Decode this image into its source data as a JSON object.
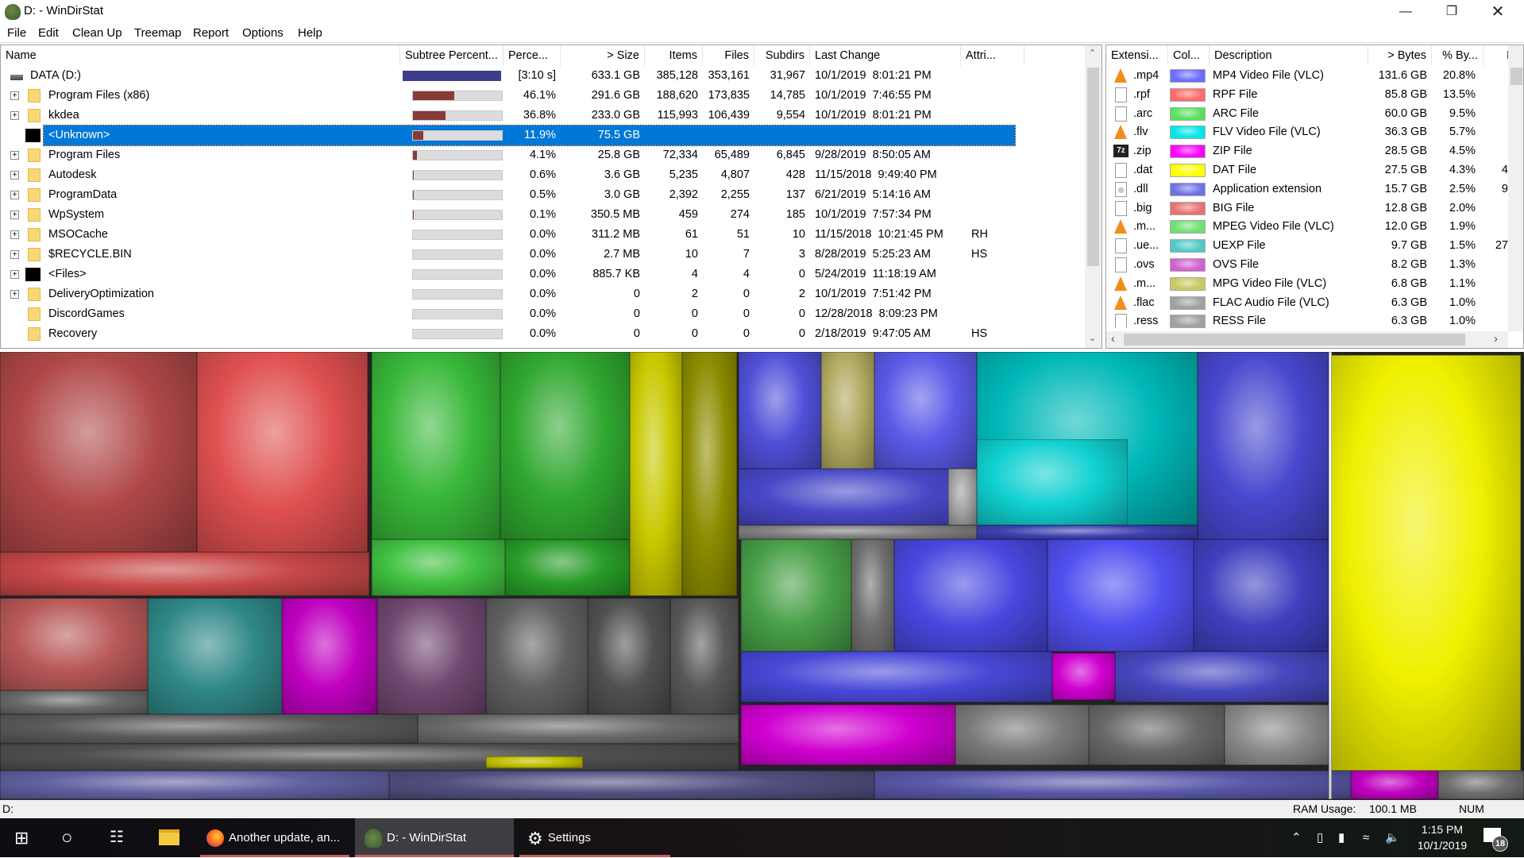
{
  "window": {
    "title": "D: - WinDirStat"
  },
  "menu": [
    "File",
    "Edit",
    "Clean Up",
    "Treemap",
    "Report",
    "Options",
    "Help"
  ],
  "tree": {
    "columns": [
      "Name",
      "Subtree Percent...",
      "Perce...",
      "> Size",
      "Items",
      "Files",
      "Subdirs",
      "Last Change",
      "Attri..."
    ],
    "rows": [
      {
        "name": "DATA (D:)",
        "icon": "drive",
        "expand": false,
        "subtree": 100,
        "perc": "[3:10 s]",
        "size": "633.1 GB",
        "items": "385,128",
        "files": "353,161",
        "subdirs": "31,967",
        "changed": "10/1/2019  8:01:21 PM",
        "attr": ""
      },
      {
        "name": "Program Files (x86)",
        "icon": "folder",
        "expand": true,
        "subtree": 46.1,
        "perc": "46.1%",
        "size": "291.6 GB",
        "items": "188,620",
        "files": "173,835",
        "subdirs": "14,785",
        "changed": "10/1/2019  7:46:55 PM",
        "attr": ""
      },
      {
        "name": "kkdea",
        "icon": "folder",
        "expand": true,
        "subtree": 36.8,
        "perc": "36.8%",
        "size": "233.0 GB",
        "items": "115,993",
        "files": "106,439",
        "subdirs": "9,554",
        "changed": "10/1/2019  8:01:21 PM",
        "attr": ""
      },
      {
        "name": "<Unknown>",
        "icon": "black",
        "expand": false,
        "selected": true,
        "subtree": 11.9,
        "perc": "11.9%",
        "size": "75.5 GB",
        "items": "",
        "files": "",
        "subdirs": "",
        "changed": "",
        "attr": ""
      },
      {
        "name": "Program Files",
        "icon": "folder",
        "expand": true,
        "subtree": 4.1,
        "perc": "4.1%",
        "size": "25.8 GB",
        "items": "72,334",
        "files": "65,489",
        "subdirs": "6,845",
        "changed": "9/28/2019  8:50:05 AM",
        "attr": ""
      },
      {
        "name": "Autodesk",
        "icon": "folder",
        "expand": true,
        "subtree": 0.6,
        "perc": "0.6%",
        "size": "3.6 GB",
        "items": "5,235",
        "files": "4,807",
        "subdirs": "428",
        "changed": "11/15/2018  9:49:40 PM",
        "attr": ""
      },
      {
        "name": "ProgramData",
        "icon": "folder",
        "expand": true,
        "subtree": 0.5,
        "perc": "0.5%",
        "size": "3.0 GB",
        "items": "2,392",
        "files": "2,255",
        "subdirs": "137",
        "changed": "6/21/2019  5:14:16 AM",
        "attr": ""
      },
      {
        "name": "WpSystem",
        "icon": "folder",
        "expand": true,
        "subtree": 0.1,
        "perc": "0.1%",
        "size": "350.5 MB",
        "items": "459",
        "files": "274",
        "subdirs": "185",
        "changed": "10/1/2019  7:57:34 PM",
        "attr": ""
      },
      {
        "name": "MSOCache",
        "icon": "folder",
        "expand": true,
        "subtree": 0.0,
        "perc": "0.0%",
        "size": "311.2 MB",
        "items": "61",
        "files": "51",
        "subdirs": "10",
        "changed": "11/15/2018  10:21:45 PM",
        "attr": "RH"
      },
      {
        "name": "$RECYCLE.BIN",
        "icon": "folder",
        "expand": true,
        "subtree": 0.0,
        "perc": "0.0%",
        "size": "2.7 MB",
        "items": "10",
        "files": "7",
        "subdirs": "3",
        "changed": "8/28/2019  5:25:23 AM",
        "attr": "HS"
      },
      {
        "name": "<Files>",
        "icon": "black",
        "expand": true,
        "subtree": 0.0,
        "perc": "0.0%",
        "size": "885.7 KB",
        "items": "4",
        "files": "4",
        "subdirs": "0",
        "changed": "5/24/2019  11:18:19 AM",
        "attr": ""
      },
      {
        "name": "DeliveryOptimization",
        "icon": "folder",
        "expand": true,
        "subtree": 0.0,
        "perc": "0.0%",
        "size": "0",
        "items": "2",
        "files": "0",
        "subdirs": "2",
        "changed": "10/1/2019  7:51:42 PM",
        "attr": ""
      },
      {
        "name": "DiscordGames",
        "icon": "folder",
        "expand": false,
        "subtree": 0.0,
        "perc": "0.0%",
        "size": "0",
        "items": "0",
        "files": "0",
        "subdirs": "0",
        "changed": "12/28/2018  8:09:23 PM",
        "attr": ""
      },
      {
        "name": "Recovery",
        "icon": "folder",
        "expand": false,
        "subtree": 0.0,
        "perc": "0.0%",
        "size": "0",
        "items": "0",
        "files": "0",
        "subdirs": "0",
        "changed": "2/18/2019  9:47:05 AM",
        "attr": "HS"
      }
    ]
  },
  "extensions": {
    "columns": [
      "Extensi...",
      "Col...",
      "Description",
      "> Bytes",
      "% By...",
      "I"
    ],
    "rows": [
      {
        "ext": ".mp4",
        "icon": "vlc",
        "color": "#6b6bff",
        "desc": "MP4 Video File (VLC)",
        "bytes": "131.6 GB",
        "pct": "20.8%",
        "files": ""
      },
      {
        "ext": ".rpf",
        "icon": "file",
        "color": "#ff6b6b",
        "desc": "RPF File",
        "bytes": "85.8 GB",
        "pct": "13.5%",
        "files": ""
      },
      {
        "ext": ".arc",
        "icon": "file",
        "color": "#5be05b",
        "desc": "ARC File",
        "bytes": "60.0 GB",
        "pct": "9.5%",
        "files": ""
      },
      {
        "ext": ".flv",
        "icon": "vlc",
        "color": "#00e5e5",
        "desc": "FLV Video File (VLC)",
        "bytes": "36.3 GB",
        "pct": "5.7%",
        "files": ""
      },
      {
        "ext": ".zip",
        "icon": "7z",
        "color": "#ff00ff",
        "desc": "ZIP File",
        "bytes": "28.5 GB",
        "pct": "4.5%",
        "files": ""
      },
      {
        "ext": ".dat",
        "icon": "file",
        "color": "#ffff00",
        "desc": "DAT File",
        "bytes": "27.5 GB",
        "pct": "4.3%",
        "files": "4"
      },
      {
        "ext": ".dll",
        "icon": "dll",
        "color": "#7070e8",
        "desc": "Application extension",
        "bytes": "15.7 GB",
        "pct": "2.5%",
        "files": "9"
      },
      {
        "ext": ".big",
        "icon": "file",
        "color": "#e87070",
        "desc": "BIG File",
        "bytes": "12.8 GB",
        "pct": "2.0%",
        "files": ""
      },
      {
        "ext": ".m...",
        "icon": "vlc",
        "color": "#70e070",
        "desc": "MPEG Video File (VLC)",
        "bytes": "12.0 GB",
        "pct": "1.9%",
        "files": ""
      },
      {
        "ext": ".ue...",
        "icon": "file",
        "color": "#50c8c8",
        "desc": "UEXP File",
        "bytes": "9.7 GB",
        "pct": "1.5%",
        "files": "27"
      },
      {
        "ext": ".ovs",
        "icon": "file",
        "color": "#d060d0",
        "desc": "OVS File",
        "bytes": "8.2 GB",
        "pct": "1.3%",
        "files": ""
      },
      {
        "ext": ".m...",
        "icon": "vlc",
        "color": "#c8c860",
        "desc": "MPG Video File (VLC)",
        "bytes": "6.8 GB",
        "pct": "1.1%",
        "files": ""
      },
      {
        "ext": ".flac",
        "icon": "vlc",
        "color": "#a0a0a0",
        "desc": "FLAC Audio File (VLC)",
        "bytes": "6.3 GB",
        "pct": "1.0%",
        "files": ""
      },
      {
        "ext": ".ress",
        "icon": "file",
        "color": "#a0a0a0",
        "desc": "RESS File",
        "bytes": "6.3 GB",
        "pct": "1.0%",
        "files": ""
      }
    ]
  },
  "status": {
    "path": "D:",
    "ram_label": "RAM Usage:",
    "ram_value": "100.1 MB",
    "num": "NUM"
  },
  "taskbar": {
    "apps": [
      {
        "label": "Another update, an..."
      },
      {
        "label": "D: - WinDirStat"
      },
      {
        "label": "Settings"
      }
    ],
    "time": "1:15 PM",
    "date": "10/1/2019",
    "notifications": "18"
  }
}
